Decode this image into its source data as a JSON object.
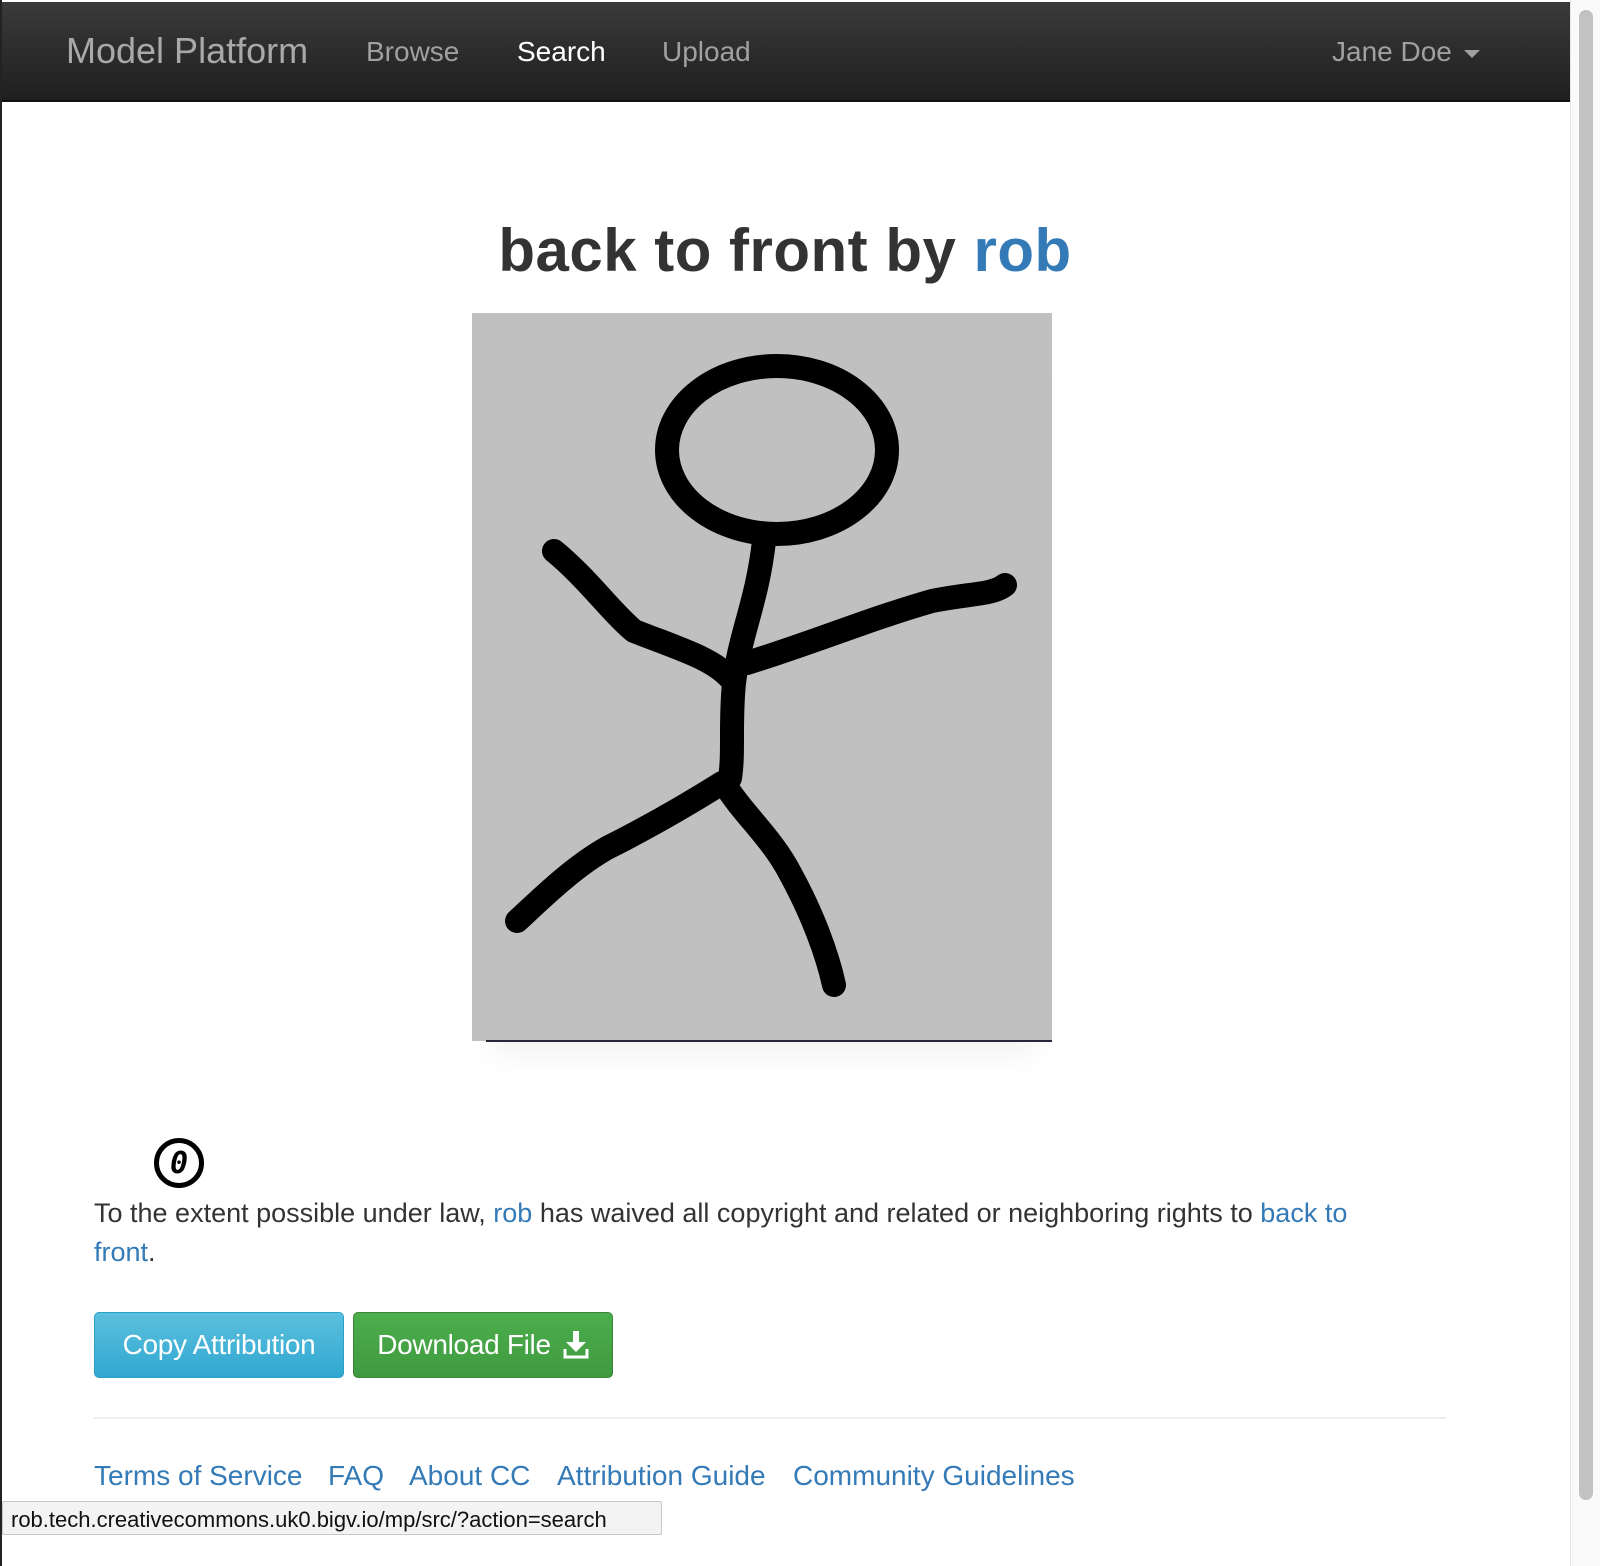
{
  "navbar": {
    "brand": "Model Platform",
    "links": [
      {
        "label": "Browse",
        "active": false
      },
      {
        "label": "Search",
        "active": true
      },
      {
        "label": "Upload",
        "active": false
      }
    ],
    "user": "Jane Doe"
  },
  "work": {
    "title_prefix": "back to front by",
    "author": "rob"
  },
  "license": {
    "icon_label": "0",
    "text_1": "To the extent possible under law,",
    "author": "rob",
    "text_2": "has waived all copyright and related or neighboring rights to",
    "work_link": "back to front",
    "text_end": "."
  },
  "actions": {
    "copy_label": "Copy Attribution",
    "download_label": "Download File"
  },
  "footer": {
    "links": [
      "Terms of Service",
      "FAQ",
      "About CC",
      "Attribution Guide",
      "Community Guidelines"
    ]
  },
  "status_bar": {
    "url": "rob.tech.creativecommons.uk0.bigv.io/mp/src/?action=search"
  },
  "colors": {
    "link": "#337ab7",
    "navbar": "#222222",
    "copy_button": "#5bc0de",
    "download_button": "#4cae4c"
  }
}
